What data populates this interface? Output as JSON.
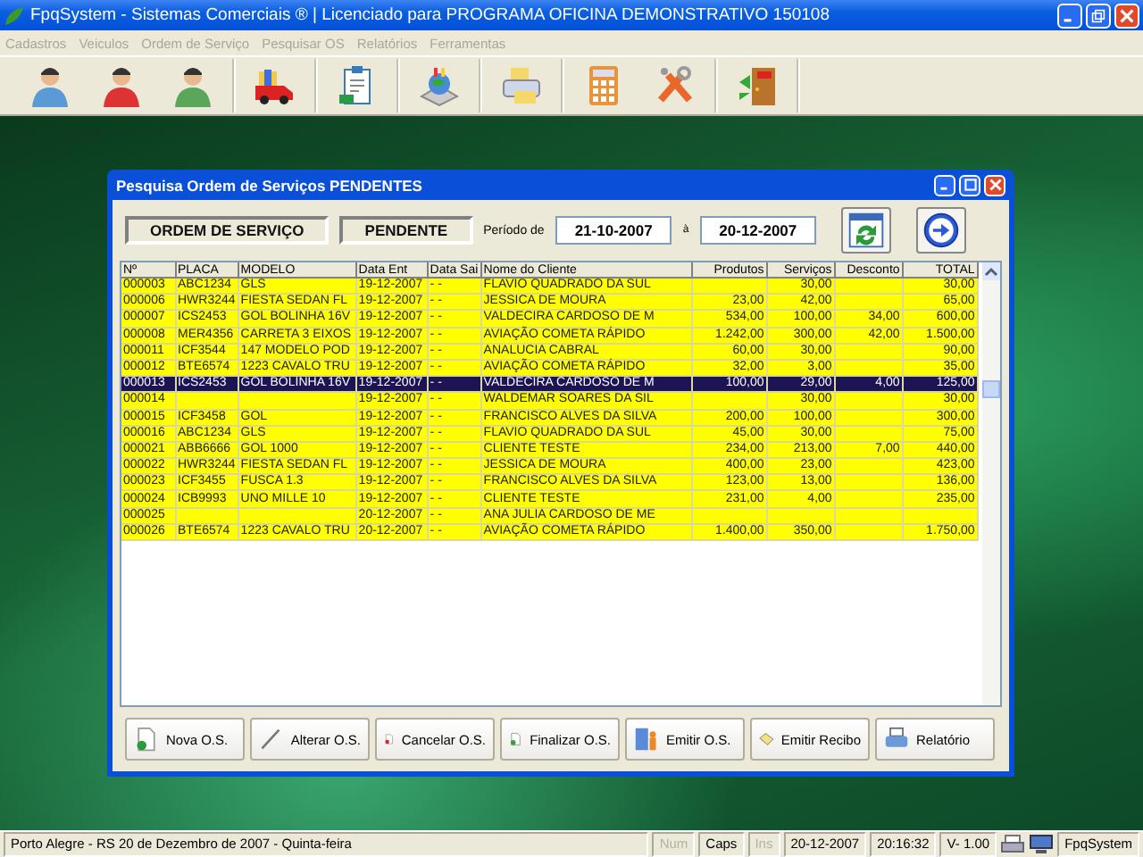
{
  "app_window": {
    "title": "FpqSystem - Sistemas Comerciais ®  | Licenciado para  PROGRAMA OFICINA DEMONSTRATIVO 150108"
  },
  "menu": [
    "Cadastros",
    "Veiculos",
    "Ordem de Serviço",
    "Pesquisar OS",
    "Relatórios",
    "Ferramentas"
  ],
  "dialog": {
    "title": "Pesquisa Ordem de Serviços PENDENTES",
    "type_label": "ORDEM DE SERVIÇO",
    "status_label": "PENDENTE",
    "period_label": "Período de",
    "date_from": "21-10-2007",
    "between_label": "à",
    "date_to": "20-12-2007"
  },
  "table": {
    "columns": [
      "Nº",
      "PLACA",
      "MODELO",
      "Data Ent",
      "Data Sai",
      "Nome do Cliente",
      "Produtos",
      "Serviços",
      "Desconto",
      "TOTAL"
    ],
    "rows": [
      {
        "selected": false,
        "cells": [
          "000003",
          "ABC1234",
          "GLS",
          "19-12-2007",
          "- -",
          "FLAVIO QUADRADO DA SUL",
          null,
          "30,00",
          null,
          "30,00"
        ]
      },
      {
        "selected": false,
        "cells": [
          "000006",
          "HWR3244",
          "FIESTA SEDAN FL",
          "19-12-2007",
          "- -",
          "JESSICA DE MOURA",
          "23,00",
          "42,00",
          null,
          "65,00"
        ]
      },
      {
        "selected": false,
        "cells": [
          "000007",
          "ICS2453",
          "GOL BOLINHA 16V",
          "19-12-2007",
          "- -",
          "VALDECIRA CARDOSO DE M",
          "534,00",
          "100,00",
          "34,00",
          "600,00"
        ]
      },
      {
        "selected": false,
        "cells": [
          "000008",
          "MER4356",
          "CARRETA 3 EIXOS",
          "19-12-2007",
          "- -",
          "AVIAÇÃO COMETA RÁPIDO",
          "1.242,00",
          "300,00",
          "42,00",
          "1.500,00"
        ]
      },
      {
        "selected": false,
        "cells": [
          "000011",
          "ICF3544",
          "147 MODELO POD",
          "19-12-2007",
          "- -",
          "ANALUCIA CABRAL",
          "60,00",
          "30,00",
          null,
          "90,00"
        ]
      },
      {
        "selected": false,
        "cells": [
          "000012",
          "BTE6574",
          "1223 CAVALO TRU",
          "19-12-2007",
          "- -",
          "AVIAÇÃO COMETA RÁPIDO",
          "32,00",
          "3,00",
          null,
          "35,00"
        ]
      },
      {
        "selected": true,
        "cells": [
          "000013",
          "ICS2453",
          "GOL BOLINHA 16V",
          "19-12-2007",
          "- -",
          "VALDECIRA CARDOSO DE M",
          "100,00",
          "29,00",
          "4,00",
          "125,00"
        ]
      },
      {
        "selected": false,
        "cells": [
          "000014",
          null,
          null,
          "19-12-2007",
          "- -",
          "WALDEMAR SOARES DA SIL",
          null,
          "30,00",
          null,
          "30,00"
        ]
      },
      {
        "selected": false,
        "cells": [
          "000015",
          "ICF3458",
          "GOL",
          "19-12-2007",
          "- -",
          "FRANCISCO ALVES DA SILVA",
          "200,00",
          "100,00",
          null,
          "300,00"
        ]
      },
      {
        "selected": false,
        "cells": [
          "000016",
          "ABC1234",
          "GLS",
          "19-12-2007",
          "- -",
          "FLAVIO QUADRADO DA SUL",
          "45,00",
          "30,00",
          null,
          "75,00"
        ]
      },
      {
        "selected": false,
        "cells": [
          "000021",
          "ABB6666",
          "GOL 1000",
          "19-12-2007",
          "- -",
          "CLIENTE TESTE",
          "234,00",
          "213,00",
          "7,00",
          "440,00"
        ]
      },
      {
        "selected": false,
        "cells": [
          "000022",
          "HWR3244",
          "FIESTA SEDAN FL",
          "19-12-2007",
          "- -",
          "JESSICA DE MOURA",
          "400,00",
          "23,00",
          null,
          "423,00"
        ]
      },
      {
        "selected": false,
        "cells": [
          "000023",
          "ICF3455",
          "FUSCA 1.3",
          "19-12-2007",
          "- -",
          "FRANCISCO ALVES DA SILVA",
          "123,00",
          "13,00",
          null,
          "136,00"
        ]
      },
      {
        "selected": false,
        "cells": [
          "000024",
          "ICB9993",
          "UNO MILLE 10",
          "19-12-2007",
          "- -",
          "CLIENTE TESTE",
          "231,00",
          "4,00",
          null,
          "235,00"
        ]
      },
      {
        "selected": false,
        "cells": [
          "000025",
          null,
          null,
          "20-12-2007",
          "- -",
          "ANA JULIA CARDOSO DE ME",
          null,
          null,
          null,
          null
        ]
      },
      {
        "selected": false,
        "cells": [
          "000026",
          "BTE6574",
          "1223 CAVALO TRU",
          "20-12-2007",
          "- -",
          "AVIAÇÃO COMETA RÁPIDO",
          "1.400,00",
          "350,00",
          null,
          "1.750,00"
        ]
      }
    ]
  },
  "buttons": [
    "Nova O.S.",
    "Alterar O.S.",
    "Cancelar O.S.",
    "Finalizar O.S.",
    "Emitir O.S.",
    "Emitir Recibo",
    "Relatório"
  ],
  "status_bar": [
    {
      "kind": "text",
      "text": "Porto Alegre - RS 20 de Dezembro de 2007 - Quinta-feira",
      "disabled": false
    },
    {
      "kind": "text",
      "text": "Num",
      "disabled": true
    },
    {
      "kind": "text",
      "text": "Caps",
      "disabled": false
    },
    {
      "kind": "text",
      "text": "Ins",
      "disabled": true
    },
    {
      "kind": "text",
      "text": "20-12-2007",
      "disabled": false
    },
    {
      "kind": "text",
      "text": "20:16:32",
      "disabled": false
    },
    {
      "kind": "text",
      "text": "V- 1.00",
      "disabled": false
    },
    {
      "kind": "printer"
    },
    {
      "kind": "monitor"
    },
    {
      "kind": "text",
      "text": "FpqSystem",
      "disabled": false
    }
  ]
}
